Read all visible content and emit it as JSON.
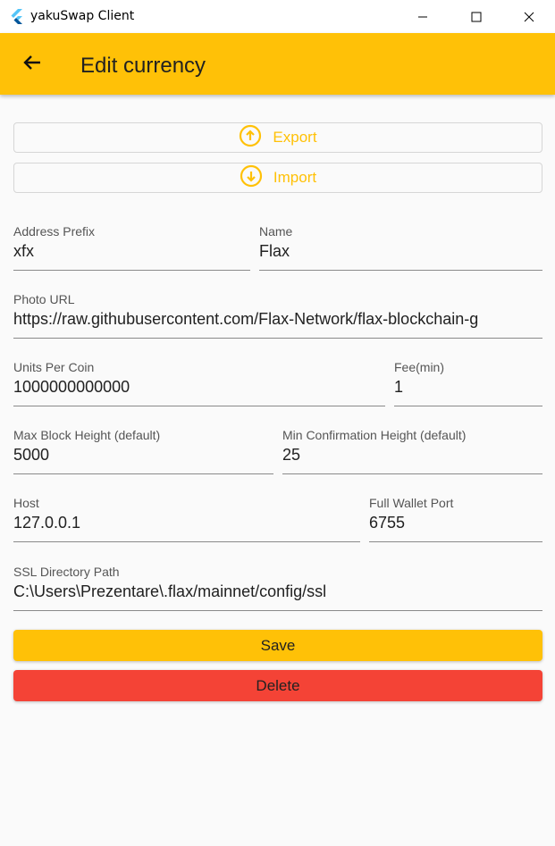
{
  "window": {
    "title": "yakuSwap Client"
  },
  "appbar": {
    "title": "Edit currency"
  },
  "actions": {
    "export_label": "Export",
    "import_label": "Import"
  },
  "fields": {
    "address_prefix": {
      "label": "Address Prefix",
      "value": "xfx"
    },
    "name": {
      "label": "Name",
      "value": "Flax"
    },
    "photo_url": {
      "label": "Photo URL",
      "value": "https://raw.githubusercontent.com/Flax-Network/flax-blockchain-g"
    },
    "units_per_coin": {
      "label": "Units Per Coin",
      "value": "1000000000000"
    },
    "fee_min": {
      "label": "Fee(min)",
      "value": "1"
    },
    "max_block_height": {
      "label": "Max Block Height (default)",
      "value": "5000"
    },
    "min_confirmation_height": {
      "label": "Min Confirmation Height (default)",
      "value": "25"
    },
    "host": {
      "label": "Host",
      "value": "127.0.0.1"
    },
    "full_wallet_port": {
      "label": "Full Wallet Port",
      "value": "6755"
    },
    "ssl_directory_path": {
      "label": "SSL Directory Path",
      "value": "C:\\Users\\Prezentare\\.flax/mainnet/config/ssl"
    }
  },
  "buttons": {
    "save_label": "Save",
    "delete_label": "Delete"
  },
  "icons": {
    "app": "flutter-logo-icon",
    "back": "arrow-left-icon",
    "export": "arrow-up-circle-icon",
    "import": "arrow-down-circle-icon",
    "minimize": "minimize-icon",
    "maximize": "maximize-icon",
    "close": "close-icon"
  },
  "colors": {
    "accent": "#ffc107",
    "danger": "#f44336",
    "background": "#fafafa"
  }
}
